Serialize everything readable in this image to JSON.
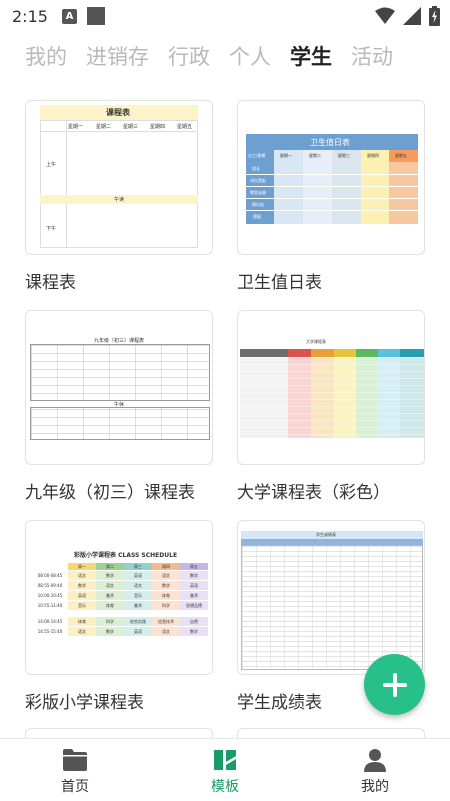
{
  "status": {
    "time": "2:15",
    "a_badge": "A"
  },
  "tabs": [
    {
      "label": "我的"
    },
    {
      "label": "进销存"
    },
    {
      "label": "行政"
    },
    {
      "label": "个人"
    },
    {
      "label": "学生"
    },
    {
      "label": "活动"
    }
  ],
  "active_tab": "学生",
  "cards": [
    {
      "label": "课程表",
      "thumb_title": "课程表",
      "thumb_row1": "上午",
      "thumb_row2": "午读",
      "thumb_row3": "下午",
      "thumb_days": [
        "星期一",
        "星期二",
        "星期三",
        "星期四",
        "星期五"
      ]
    },
    {
      "label": "卫生值日表",
      "thumb_title": "卫生值日表",
      "thumb_head": [
        "分工/星期",
        "星期一",
        "星期二",
        "星期三",
        "星期四",
        "星期五"
      ],
      "thumb_rows": [
        "组长",
        "讲台黑板",
        "教室走廊",
        "倒垃圾",
        "擦窗"
      ]
    },
    {
      "label": "九年级（初三）课程表",
      "thumb_title": "九年级（初三）课程表",
      "thumb_mid": "午休"
    },
    {
      "label": "大学课程表（彩色）",
      "thumb_title": "大学课程表"
    },
    {
      "label": "彩版小学课程表",
      "thumb_title": "彩版小学课程表 CLASS SCHEDULE",
      "thumb_head": [
        "",
        "周一",
        "周二",
        "周三",
        "周四",
        "周五"
      ],
      "thumb_rows": [
        [
          "08:00-08:45",
          "语文",
          "数学",
          "英语",
          "语文",
          "数学"
        ],
        [
          "08:55-09:40",
          "数学",
          "语文",
          "语文",
          "数学",
          "英语"
        ],
        [
          "10:00-10:45",
          "英语",
          "美术",
          "音乐",
          "体育",
          "美术"
        ],
        [
          "10:55-11:40",
          "音乐",
          "体育",
          "美术",
          "科学",
          "思想品德"
        ],
        [
          "14:00-14:45",
          "体育",
          "科学",
          "综合实践",
          "信息技术",
          "自然"
        ],
        [
          "14:55-15:40",
          "语文",
          "数学",
          "英语",
          "语文",
          "数学"
        ]
      ]
    },
    {
      "label": "学生成绩表",
      "thumb_title": "学生成绩表"
    }
  ],
  "fab": {
    "icon": "plus-icon"
  },
  "nav": [
    {
      "label": "首页",
      "icon": "folder-icon"
    },
    {
      "label": "模板",
      "icon": "template-icon"
    },
    {
      "label": "我的",
      "icon": "person-icon"
    }
  ],
  "colors": {
    "accent": "#1a9b69",
    "fab": "#28c08a",
    "tab_inactive": "#b9b9b9",
    "tab_active": "#222222"
  }
}
